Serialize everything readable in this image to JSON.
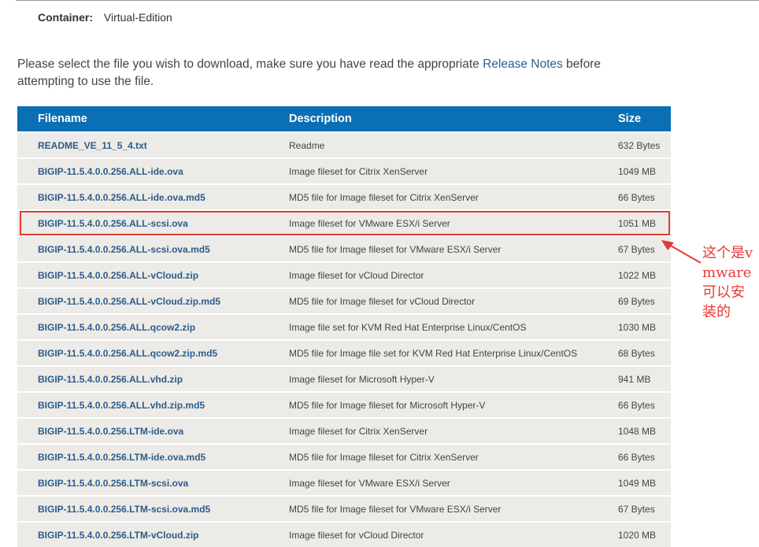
{
  "container": {
    "label": "Container:",
    "value": "Virtual-Edition"
  },
  "intro": {
    "before": "Please select the file you wish to download, make sure you have read the appropriate ",
    "link": "Release Notes",
    "after": " before attempting to use the file."
  },
  "table": {
    "headers": [
      "Filename",
      "Description",
      "Size"
    ],
    "rows": [
      [
        "README_VE_11_5_4.txt",
        "Readme",
        "632 Bytes"
      ],
      [
        "BIGIP-11.5.4.0.0.256.ALL-ide.ova",
        "Image fileset for Citrix XenServer",
        "1049 MB"
      ],
      [
        "BIGIP-11.5.4.0.0.256.ALL-ide.ova.md5",
        "MD5 file for Image fileset for Citrix XenServer",
        "66 Bytes"
      ],
      [
        "BIGIP-11.5.4.0.0.256.ALL-scsi.ova",
        "Image fileset for VMware ESX/i Server",
        "1051 MB"
      ],
      [
        "BIGIP-11.5.4.0.0.256.ALL-scsi.ova.md5",
        "MD5 file for Image fileset for VMware ESX/i Server",
        "67 Bytes"
      ],
      [
        "BIGIP-11.5.4.0.0.256.ALL-vCloud.zip",
        "Image fileset for vCloud Director",
        "1022 MB"
      ],
      [
        "BIGIP-11.5.4.0.0.256.ALL-vCloud.zip.md5",
        "MD5 file for Image fileset for vCloud Director",
        "69 Bytes"
      ],
      [
        "BIGIP-11.5.4.0.0.256.ALL.qcow2.zip",
        "Image file set for KVM Red Hat Enterprise Linux/CentOS",
        "1030 MB"
      ],
      [
        "BIGIP-11.5.4.0.0.256.ALL.qcow2.zip.md5",
        "MD5 file for Image file set for KVM Red Hat Enterprise Linux/CentOS",
        "68 Bytes"
      ],
      [
        "BIGIP-11.5.4.0.0.256.ALL.vhd.zip",
        "Image fileset for Microsoft Hyper-V",
        "941 MB"
      ],
      [
        "BIGIP-11.5.4.0.0.256.ALL.vhd.zip.md5",
        "MD5 file for Image fileset for Microsoft Hyper-V",
        "66 Bytes"
      ],
      [
        "BIGIP-11.5.4.0.0.256.LTM-ide.ova",
        "Image fileset for Citrix XenServer",
        "1048 MB"
      ],
      [
        "BIGIP-11.5.4.0.0.256.LTM-ide.ova.md5",
        "MD5 file for Image fileset for Citrix XenServer",
        "66 Bytes"
      ],
      [
        "BIGIP-11.5.4.0.0.256.LTM-scsi.ova",
        "Image fileset for VMware ESX/i Server",
        "1049 MB"
      ],
      [
        "BIGIP-11.5.4.0.0.256.LTM-scsi.ova.md5",
        "MD5 file for Image fileset for VMware ESX/i Server",
        "67 Bytes"
      ],
      [
        "BIGIP-11.5.4.0.0.256.LTM-vCloud.zip",
        "Image fileset for vCloud Director",
        "1020 MB"
      ]
    ]
  },
  "annotation": {
    "text": "这个是vmware可以安装的",
    "color": "#e53935"
  },
  "colors": {
    "header_bg": "#0a6fb4",
    "row_bg": "#ecebe7",
    "link": "#2d5c8c"
  }
}
